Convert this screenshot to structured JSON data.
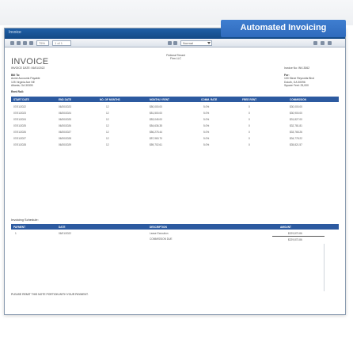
{
  "badge": {
    "label": "Automated Invoicing"
  },
  "window": {
    "title": "Invoice"
  },
  "toolbar": {
    "zoom": "75%",
    "page": "1 of 1",
    "style": "Normal"
  },
  "invoice": {
    "title": "INVOICE",
    "date": "INVOICE DATE: 06/01/2022",
    "firm": [
      "Fictional Tenant",
      "Firm LLC"
    ],
    "invoice_no": "Invoice No: INV-3062",
    "bill_to": {
      "label": "Bill To:",
      "lines": [
        "Acme Accounts Payable",
        "125 Virginia Ave NE",
        "Atlanta, GA 30305"
      ]
    },
    "for": {
      "label": "For:",
      "lines": [
        "100 Steve Reynolds Blvd",
        "Duluth, GA 30096",
        "Square Feet: 25,000"
      ]
    },
    "rent_roll_label": "Rent Roll:",
    "table": {
      "headers": [
        "START DATE",
        "END DATE",
        "NO. OF MONTHS",
        "MONTHLY RENT",
        "COMM. RATE",
        "FREE RENT",
        "COMMISSION"
      ],
      "rows": [
        [
          "07/01/2022",
          "06/30/2023",
          "12",
          "$50,000.00",
          "5.0%",
          "0",
          "$30,000.00"
        ],
        [
          "07/01/2023",
          "06/30/2024",
          "12",
          "$51,500.00",
          "5.0%",
          "0",
          "$30,900.00"
        ],
        [
          "07/01/2024",
          "06/30/2025",
          "12",
          "$53,045.00",
          "5.0%",
          "0",
          "$31,827.00"
        ],
        [
          "07/01/2025",
          "06/30/2026",
          "12",
          "$54,636.35",
          "5.0%",
          "0",
          "$32,781.81"
        ],
        [
          "07/01/2026",
          "06/30/2027",
          "12",
          "$56,275.44",
          "5.0%",
          "0",
          "$33,765.26"
        ],
        [
          "07/01/2027",
          "06/30/2028",
          "12",
          "$57,963.70",
          "5.0%",
          "0",
          "$34,778.22"
        ],
        [
          "07/01/2028",
          "06/30/2029",
          "12",
          "$59,702.61",
          "5.0%",
          "0",
          "$35,821.57"
        ]
      ]
    },
    "schedule": {
      "title": "Invoicing Schedule:",
      "headers": [
        "PAYMENT",
        "DATE",
        "DESCRIPTION",
        "AMOUNT"
      ],
      "row": [
        "1",
        "06/01/2022",
        "Lease Execution",
        "$229,873.86"
      ],
      "due_label": "COMMISSION DUE",
      "due_amount": "$229,873.86"
    },
    "note": "PLEASE REMIT THIS NOTE PORTION WITH YOUR PAYMENT."
  },
  "colors": {
    "header_blue": "#2c5aa0",
    "badge_blue": "#3a78cc"
  }
}
